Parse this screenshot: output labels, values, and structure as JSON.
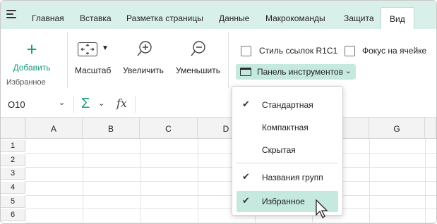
{
  "tabs": [
    "Главная",
    "Вставка",
    "Разметка страницы",
    "Данные",
    "Макрокоманды",
    "Защита",
    "Вид"
  ],
  "active_tab": "Вид",
  "ribbon": {
    "add_label": "Добавить",
    "favorites_group_label": "Избранное",
    "scale_label": "Масштаб",
    "zoom_in_label": "Увеличить",
    "zoom_out_label": "Уменьшить",
    "r1c1_label": "Стиль ссылок R1C1",
    "focus_label": "Фокус на ячейке",
    "toolbar_button_label": "Панель инструментов"
  },
  "formula_bar": {
    "cell_ref": "O10",
    "fx": "fx"
  },
  "grid": {
    "columns": [
      "A",
      "B",
      "C",
      "D",
      "",
      "",
      "G"
    ],
    "rows": [
      "1",
      "2",
      "3",
      "4",
      "5",
      "6"
    ]
  },
  "dropdown": {
    "items": [
      {
        "label": "Стандартная",
        "checked": true
      },
      {
        "label": "Компактная",
        "checked": false
      },
      {
        "label": "Скрытая",
        "checked": false
      },
      {
        "label": "Названия групп",
        "checked": true
      },
      {
        "label": "Избранное",
        "checked": true,
        "hover": true
      }
    ]
  },
  "colors": {
    "accent": "#1a9a7e",
    "tabbar_bg": "#d9f0ea",
    "highlight": "#c5e8df"
  }
}
